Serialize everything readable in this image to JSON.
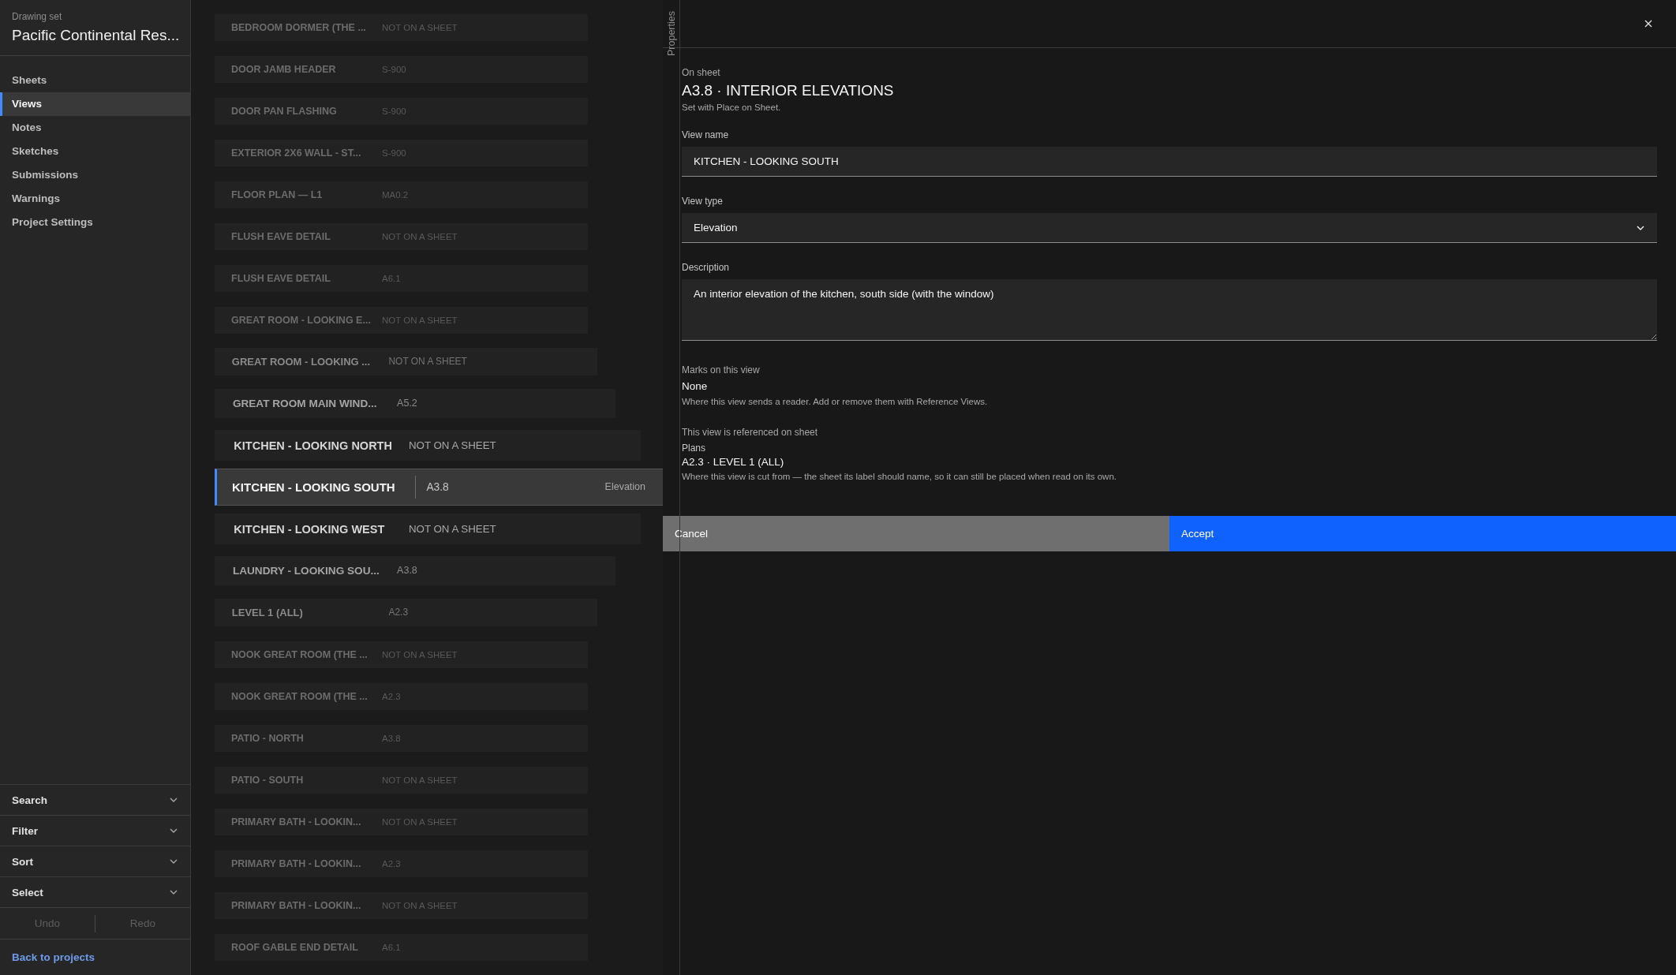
{
  "sidebar": {
    "set_label": "Drawing set",
    "set_name": "Pacific Continental Res...",
    "nav": [
      {
        "label": "Sheets",
        "selected": false
      },
      {
        "label": "Views",
        "selected": true
      },
      {
        "label": "Notes",
        "selected": false
      },
      {
        "label": "Sketches",
        "selected": false
      },
      {
        "label": "Submissions",
        "selected": false
      },
      {
        "label": "Warnings",
        "selected": false
      },
      {
        "label": "Project Settings",
        "selected": false
      }
    ],
    "panels": [
      {
        "label": "Search"
      },
      {
        "label": "Filter"
      },
      {
        "label": "Sort"
      },
      {
        "label": "Select"
      }
    ],
    "history": [
      {
        "label": "Undo",
        "disabled": true
      },
      {
        "label": "Redo",
        "disabled": true
      }
    ],
    "back_link": "Back to projects"
  },
  "views_list": {
    "rows": [
      {
        "name": "BEDROOM DORMER (THE ...",
        "sheet": "NOT ON A SHEET",
        "selected": false
      },
      {
        "name": "DOOR JAMB HEADER",
        "sheet": "S-900",
        "selected": false
      },
      {
        "name": "DOOR PAN FLASHING",
        "sheet": "S-900",
        "selected": false
      },
      {
        "name": "EXTERIOR 2X6 WALL - ST...",
        "sheet": "S-900",
        "selected": false
      },
      {
        "name": "FLOOR PLAN — L1",
        "sheet": "MA0.2",
        "selected": false
      },
      {
        "name": "FLUSH EAVE DETAIL",
        "sheet": "NOT ON A SHEET",
        "selected": false
      },
      {
        "name": "FLUSH EAVE DETAIL",
        "sheet": "A6.1",
        "selected": false
      },
      {
        "name": "GREAT ROOM - LOOKING E...",
        "sheet": "NOT ON A SHEET",
        "selected": false
      },
      {
        "name": "GREAT ROOM - LOOKING ...",
        "sheet": "NOT ON A SHEET",
        "selected": false
      },
      {
        "name": "GREAT ROOM MAIN WIND...",
        "sheet": "A5.2",
        "selected": false
      },
      {
        "name": "KITCHEN - LOOKING NORTH",
        "sheet": "NOT ON A SHEET",
        "selected": false
      },
      {
        "name": "KITCHEN - LOOKING SOUTH",
        "sheet": "A3.8",
        "selected": true,
        "type": "Elevation"
      },
      {
        "name": "KITCHEN - LOOKING WEST",
        "sheet": "NOT ON A SHEET",
        "selected": false
      },
      {
        "name": "LAUNDRY - LOOKING SOU...",
        "sheet": "A3.8",
        "selected": false
      },
      {
        "name": "LEVEL 1 (ALL)",
        "sheet": "A2.3",
        "selected": false
      },
      {
        "name": "NOOK GREAT ROOM (THE ...",
        "sheet": "NOT ON A SHEET",
        "selected": false
      },
      {
        "name": "NOOK GREAT ROOM (THE ...",
        "sheet": "A2.3",
        "selected": false
      },
      {
        "name": "PATIO - NORTH",
        "sheet": "A3.8",
        "selected": false
      },
      {
        "name": "PATIO - SOUTH",
        "sheet": "NOT ON A SHEET",
        "selected": false
      },
      {
        "name": "PRIMARY BATH - LOOKIN...",
        "sheet": "NOT ON A SHEET",
        "selected": false
      },
      {
        "name": "PRIMARY BATH - LOOKIN...",
        "sheet": "A2.3",
        "selected": false
      },
      {
        "name": "PRIMARY BATH - LOOKIN...",
        "sheet": "NOT ON A SHEET",
        "selected": false
      },
      {
        "name": "ROOF GABLE END DETAIL",
        "sheet": "A6.1",
        "selected": false
      }
    ]
  },
  "properties_tab": "Properties",
  "properties": {
    "on_sheet_label": "On sheet",
    "sheet_title": "A3.8 · INTERIOR ELEVATIONS",
    "sheet_hint": "Set with Place on Sheet.",
    "fields": [
      {
        "kind": "text",
        "label": "View name",
        "value": "KITCHEN - LOOKING SOUTH"
      },
      {
        "kind": "select",
        "label": "View type",
        "value": "Elevation"
      },
      {
        "kind": "textarea",
        "label": "Description",
        "value": "An interior elevation of the kitchen, south side (with the window)"
      }
    ],
    "marks": {
      "label": "Marks on this view",
      "value": "None",
      "hint": "Where this view sends a reader. Add or remove them with Reference Views."
    },
    "referenced": {
      "label": "This view is referenced on sheet",
      "group": "Plans",
      "value": "A2.3 · LEVEL 1 (ALL)",
      "hint": "Where this view is cut from — the sheet its label should name, so it can still be placed when read on its own."
    },
    "buttons": [
      {
        "label": "Cancel",
        "kind": "secondary"
      },
      {
        "label": "Accept",
        "kind": "primary"
      }
    ]
  }
}
